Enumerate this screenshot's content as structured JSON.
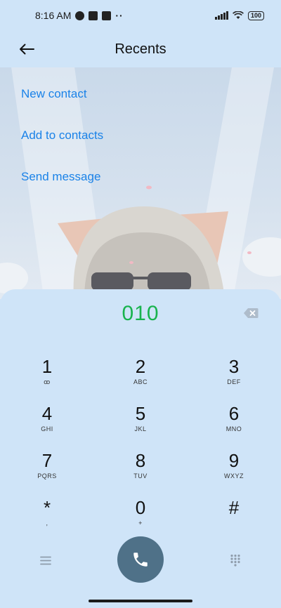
{
  "status_bar": {
    "time": "8:16 AM",
    "more": "··",
    "battery": "100"
  },
  "header": {
    "title": "Recents",
    "back_icon": "arrow-left-icon"
  },
  "actions": {
    "new_contact": "New contact",
    "add_to_contacts": "Add to contacts",
    "send_message": "Send message"
  },
  "dialer": {
    "number": "010",
    "keys": [
      {
        "digit": "1",
        "letters": "ꝏ"
      },
      {
        "digit": "2",
        "letters": "ABC"
      },
      {
        "digit": "3",
        "letters": "DEF"
      },
      {
        "digit": "4",
        "letters": "GHI"
      },
      {
        "digit": "5",
        "letters": "JKL"
      },
      {
        "digit": "6",
        "letters": "MNO"
      },
      {
        "digit": "7",
        "letters": "PQRS"
      },
      {
        "digit": "8",
        "letters": "TUV"
      },
      {
        "digit": "9",
        "letters": "WXYZ"
      },
      {
        "digit": "*",
        "letters": ","
      },
      {
        "digit": "0",
        "letters": "+"
      },
      {
        "digit": "#",
        "letters": ""
      }
    ]
  },
  "colors": {
    "accent_link": "#1a82e8",
    "dialed_number": "#19b34e",
    "call_button": "#4f7188",
    "panel_bg": "#cfe4f8"
  }
}
